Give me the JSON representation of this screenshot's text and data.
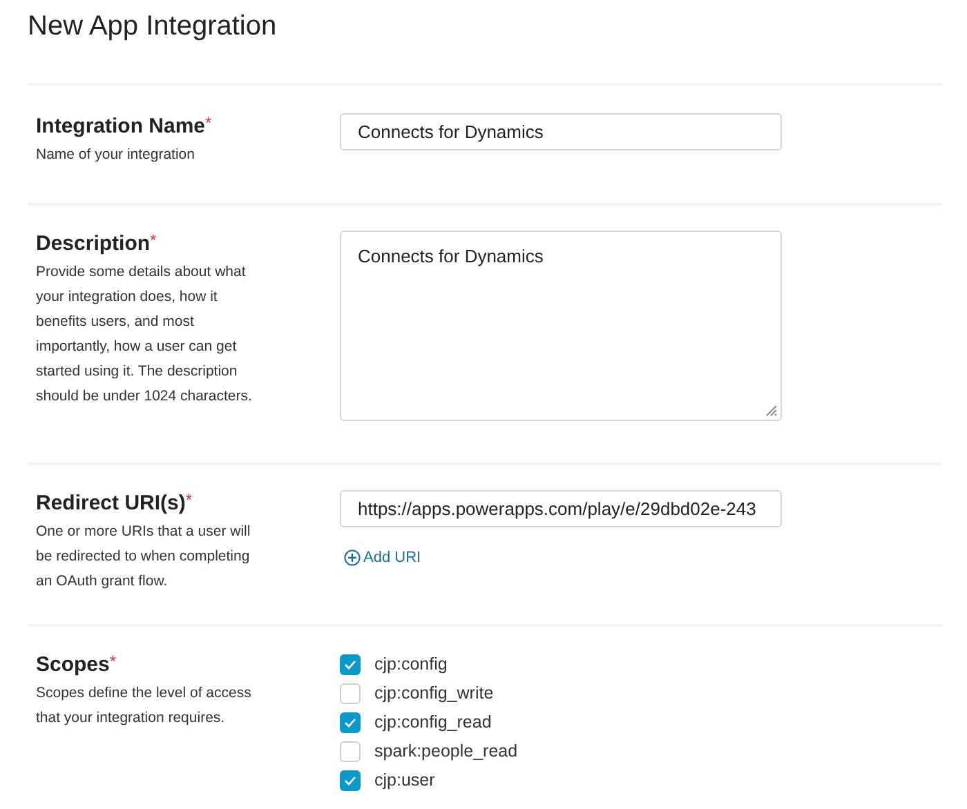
{
  "title": "New App Integration",
  "sections": [
    {
      "kind": "input",
      "label": "Integration Name",
      "required_mark": "*",
      "help": "Name of your integration",
      "value": "Connects for Dynamics"
    },
    {
      "kind": "textarea",
      "label": "Description",
      "required_mark": "*",
      "help": "Provide some details about what your integration does, how it benefits users, and most importantly, how a user can get started using it. The description should be under 1024 characters.",
      "value": "Connects for Dynamics"
    },
    {
      "kind": "uri",
      "label": "Redirect URI(s)",
      "required_mark": "*",
      "help": "One or more URIs that a user will be redirected to when completing an OAuth grant flow.",
      "value": "https://apps.powerapps.com/play/e/29dbd02e-243",
      "add_link": "Add URI"
    },
    {
      "kind": "scopes",
      "label": "Scopes",
      "required_mark": "*",
      "help": "Scopes define the level of access that your integration requires.",
      "scopes": [
        {
          "label": "cjp:config",
          "checked": true
        },
        {
          "label": "cjp:config_write",
          "checked": false
        },
        {
          "label": "cjp:config_read",
          "checked": true
        },
        {
          "label": "spark:people_read",
          "checked": false
        },
        {
          "label": "cjp:user",
          "checked": true
        }
      ]
    }
  ]
}
